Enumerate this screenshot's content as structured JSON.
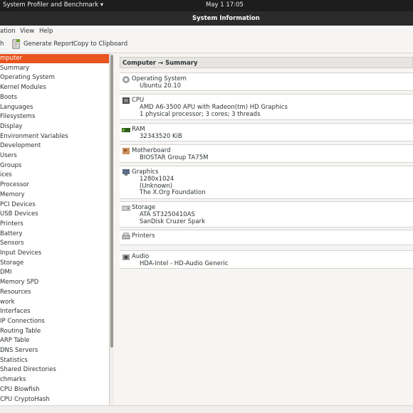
{
  "topbar": {
    "app_menu": "System Profiler and Benchmark ▾",
    "clock": "May 1  17:05"
  },
  "window": {
    "title": "System Information"
  },
  "menubar": {
    "items": [
      "ation",
      "View",
      "Help"
    ]
  },
  "toolbar": {
    "refresh_partial": "h",
    "generate_report": "Generate Report",
    "copy_clipboard": "Copy to Clipboard"
  },
  "sidebar": {
    "items": [
      "mputer",
      "Summary",
      "Operating System",
      "Kernel Modules",
      "Boots",
      "Languages",
      "Filesystems",
      "Display",
      "Environment Variables",
      "Development",
      "Users",
      "Groups",
      "ices",
      "Processor",
      "Memory",
      "PCI Devices",
      "USB Devices",
      "Printers",
      "Battery",
      "Sensors",
      "Input Devices",
      "Storage",
      "DMI",
      "Memory SPD",
      "Resources",
      "work",
      "Interfaces",
      "IP Connections",
      "Routing Table",
      "ARP Table",
      "DNS Servers",
      "Statistics",
      "Shared Directories",
      "chmarks",
      "CPU Blowfish",
      "CPU CryptoHash"
    ],
    "selected_index": 0
  },
  "main": {
    "breadcrumb": "Computer → Summary",
    "sections": [
      {
        "icon": "operating-system-icon",
        "title": "Operating System",
        "lines": [
          "Ubuntu 20.10"
        ]
      },
      {
        "icon": "cpu-icon",
        "title": "CPU",
        "lines": [
          "AMD A6-3500 APU with Radeon(tm) HD Graphics",
          "1 physical processor; 3 cores; 3 threads"
        ]
      },
      {
        "icon": "ram-icon",
        "title": "RAM",
        "lines": [
          "32343520 KiB"
        ]
      },
      {
        "icon": "motherboard-icon",
        "title": "Motherboard",
        "lines": [
          "BIOSTAR Group TA75M"
        ]
      },
      {
        "icon": "graphics-icon",
        "title": "Graphics",
        "lines": [
          "1280x1024",
          "(Unknown)",
          "The X.Org Foundation"
        ]
      },
      {
        "icon": "storage-icon",
        "title": "Storage",
        "lines": [
          "ATA ST3250410AS",
          "SanDisk Cruzer Spark"
        ]
      },
      {
        "icon": "printer-icon",
        "title": "Printers",
        "lines": []
      },
      {
        "icon": "audio-icon",
        "title": "Audio",
        "lines": [
          "HDA-Intel - HD-Audio Generic"
        ]
      }
    ]
  },
  "colors": {
    "selection": "#e95420",
    "topbar": "#1d1d1d",
    "titlebar": "#2b2b2b"
  }
}
